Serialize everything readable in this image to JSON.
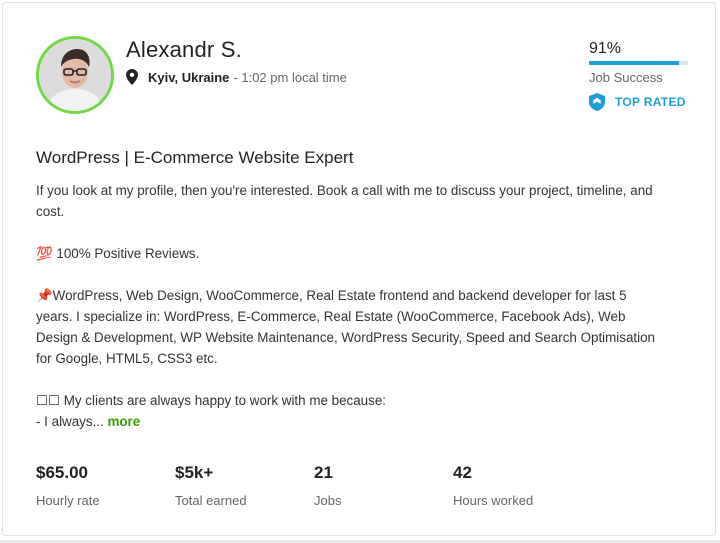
{
  "profile": {
    "name": "Alexandr S.",
    "city": "Kyiv, Ukraine",
    "local_time": "- 1:02 pm local time"
  },
  "job_success": {
    "percent_label": "91%",
    "percent_value": 0.91,
    "label": "Job Success",
    "badge": "TOP RATED",
    "accent": "#1f9ed6",
    "badge_color": "#1d9ed8"
  },
  "headline": "WordPress | E-Commerce Website Expert",
  "description": {
    "p1": "If you look at my profile, then you're interested. Book a call with me to discuss your project, timeline, and cost.",
    "p2": "💯 100% Positive Reviews.",
    "p3": "📌WordPress, Web Design, WooCommerce, Real Estate frontend and backend developer for last 5 years. I specialize in: WordPress, E-Commerce, Real Estate (WooCommerce, Facebook Ads), Web Design & Development, WP Website Maintenance, WordPress Security, Speed and Search Optimisation for Google, HTML5, CSS3 etc.",
    "p4_line1": "☐☐ My clients are always happy to work with me because:",
    "p4_line2": "- I always...",
    "more": "more",
    "more_color": "#37a000"
  },
  "stats": [
    {
      "value": "$65.00",
      "label": "Hourly rate"
    },
    {
      "value": "$5k+",
      "label": "Total earned"
    },
    {
      "value": "21",
      "label": "Jobs"
    },
    {
      "value": "42",
      "label": "Hours worked"
    }
  ],
  "icons": {
    "location": "map-pin-icon",
    "badge": "shield-icon",
    "avatar_border": "#6fda44"
  }
}
